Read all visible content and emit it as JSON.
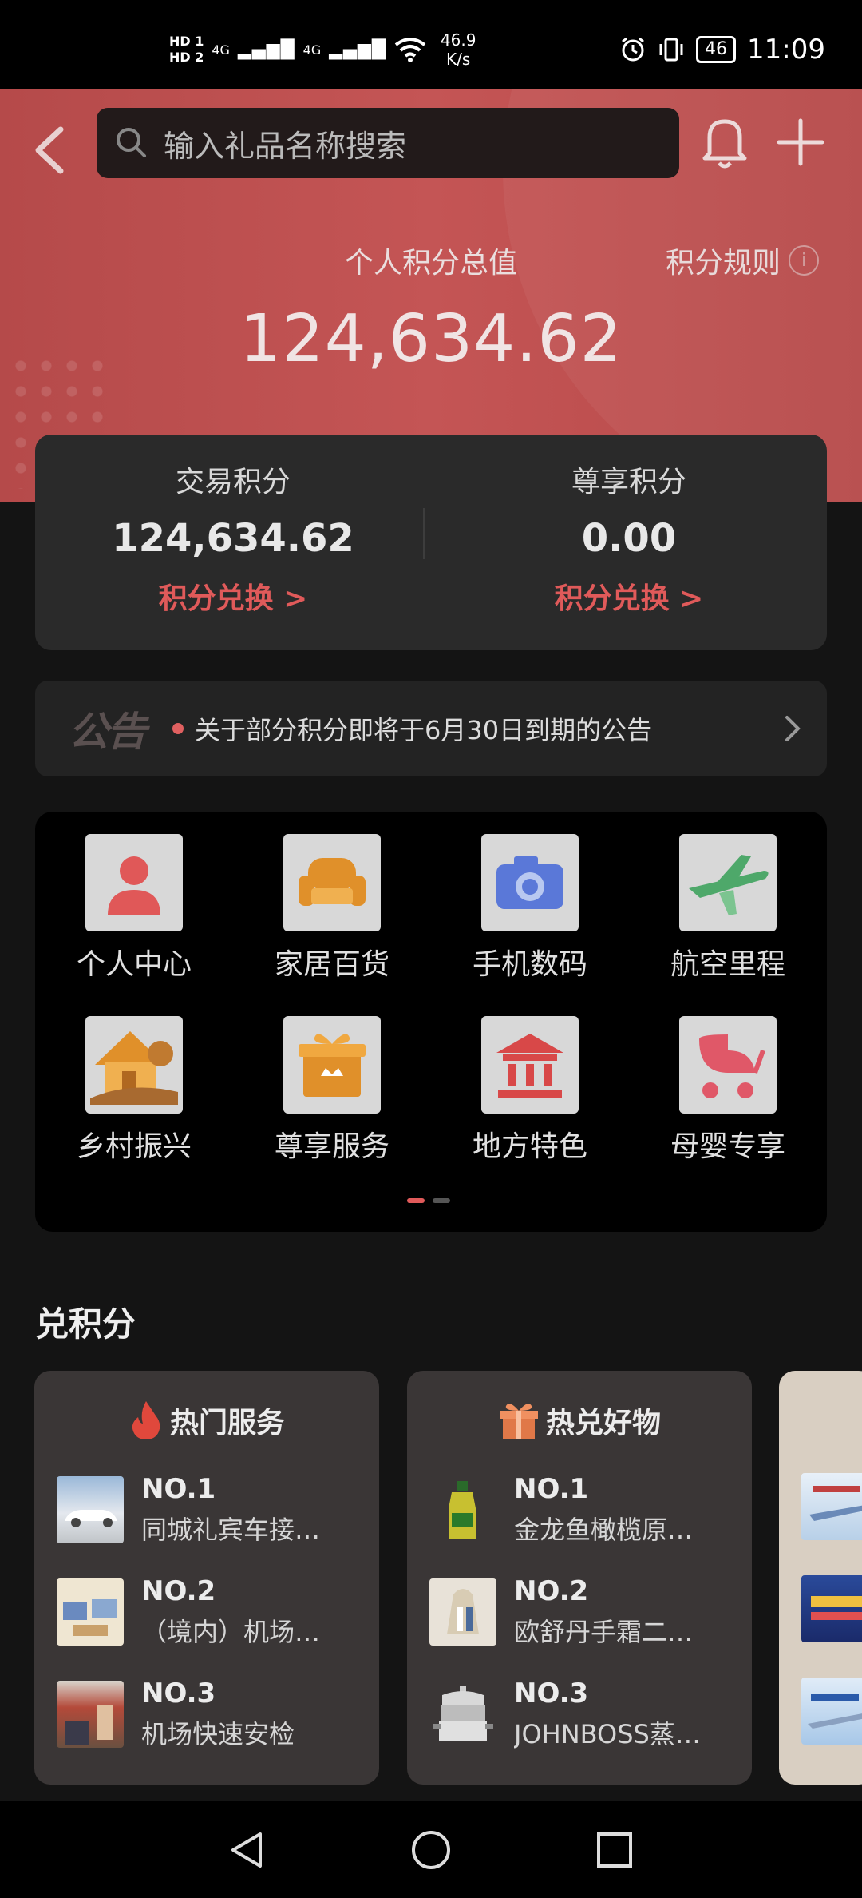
{
  "status_bar": {
    "hd1": "HD 1",
    "hd2": "HD 2",
    "net1": "4G",
    "net2": "4G",
    "speed_value": "46.9",
    "speed_unit": "K/s",
    "battery": "46",
    "time": "11:09"
  },
  "header": {
    "search_placeholder": "输入礼品名称搜索",
    "total_label": "个人积分总值",
    "rules_label": "积分规则",
    "total_value": "124,634.62"
  },
  "points": {
    "trade": {
      "title": "交易积分",
      "value": "124,634.62",
      "link": "积分兑换 >"
    },
    "exclusive": {
      "title": "尊享积分",
      "value": "0.00",
      "link": "积分兑换 >"
    }
  },
  "notice": {
    "logo": "公告",
    "text": "关于部分积分即将于6月30日到期的公告"
  },
  "categories": [
    {
      "label": "个人中心",
      "icon": "person-icon"
    },
    {
      "label": "家居百货",
      "icon": "sofa-icon"
    },
    {
      "label": "手机数码",
      "icon": "camera-icon"
    },
    {
      "label": "航空里程",
      "icon": "airplane-icon"
    },
    {
      "label": "乡村振兴",
      "icon": "village-house-icon"
    },
    {
      "label": "尊享服务",
      "icon": "gift-box-icon"
    },
    {
      "label": "地方特色",
      "icon": "landmark-icon"
    },
    {
      "label": "母婴专享",
      "icon": "stroller-icon"
    }
  ],
  "section_title": "兑积分",
  "rank_cards": [
    {
      "title": "热门服务",
      "icon": "flame-icon",
      "items": [
        {
          "no": "NO.1",
          "name": "同城礼宾车接…"
        },
        {
          "no": "NO.2",
          "name": "（境内）机场…"
        },
        {
          "no": "NO.3",
          "name": "机场快速安检"
        }
      ]
    },
    {
      "title": "热兑好物",
      "icon": "gift-icon",
      "items": [
        {
          "no": "NO.1",
          "name": "金龙鱼橄榄原…"
        },
        {
          "no": "NO.2",
          "name": "欧舒丹手霜二…"
        },
        {
          "no": "NO.3",
          "name": "JOHNBOSS蒸…"
        }
      ]
    }
  ]
}
